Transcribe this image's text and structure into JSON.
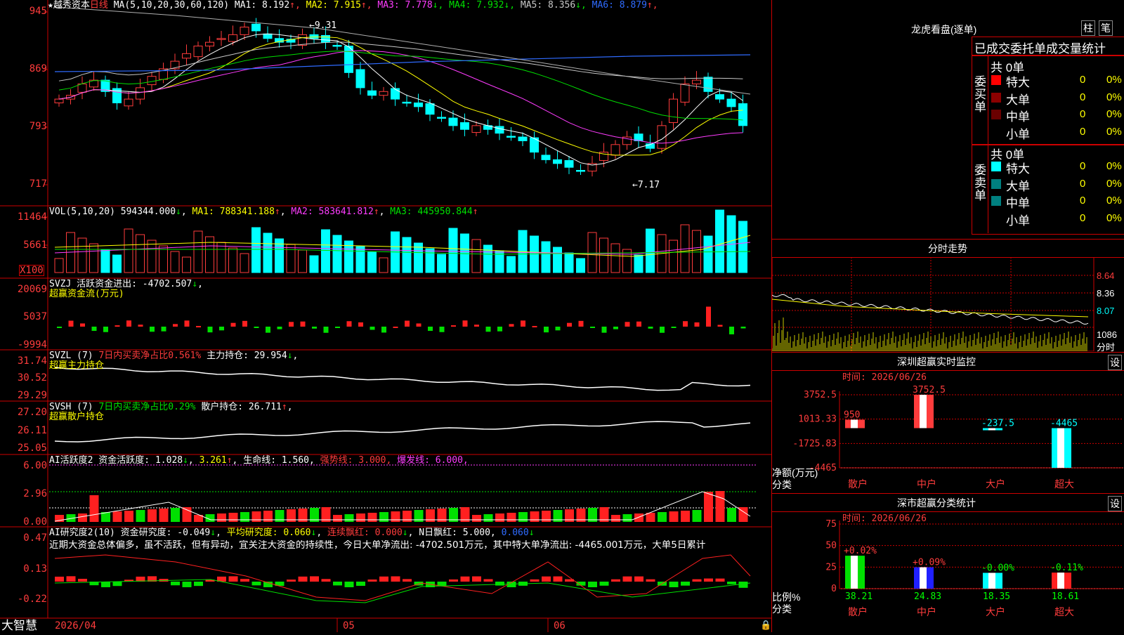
{
  "price_panel": {
    "stock": "越秀资本",
    "period": "日线",
    "ma_params": "MA(5,10,20,30,60,120)",
    "ma": [
      {
        "label": "MA1:",
        "value": "8.192",
        "arrow": "↑",
        "color": "#ffffff"
      },
      {
        "label": "MA2:",
        "value": "7.915",
        "arrow": "↑",
        "color": "#ffff00"
      },
      {
        "label": "MA3:",
        "value": "7.778",
        "arrow": "↓",
        "color": "#ff3cff"
      },
      {
        "label": "MA4:",
        "value": "7.932",
        "arrow": "↓",
        "color": "#00e000"
      },
      {
        "label": "MA5:",
        "value": "8.356",
        "arrow": "↓",
        "color": "#c8c8c8"
      },
      {
        "label": "MA6:",
        "value": "8.879",
        "arrow": "↑",
        "color": "#2f6bff"
      }
    ],
    "y_ticks": [
      "945",
      "869",
      "793",
      "717"
    ],
    "high_label": "9.31",
    "low_label": "7.17"
  },
  "vol_panel": {
    "header": "VOL(5,10,20)",
    "value": "594344.000",
    "value_arrow": "↓",
    "ma1": "MA1: 788341.188",
    "ma1_arrow": "↑",
    "ma2": "MA2: 583641.812",
    "ma2_arrow": "↑",
    "ma3": "MA3: 445950.844",
    "ma3_arrow": "↑",
    "y_ticks": [
      "11464",
      "5661"
    ],
    "unit": "X100"
  },
  "svzj_panel": {
    "header": "SVZJ  活跃资金进出: -4702.507",
    "arrow": "↓",
    "sub": "超赢资金流(万元)",
    "y_ticks": [
      "20069",
      "5037",
      "-9994"
    ]
  },
  "svzl_panel": {
    "header": "SVZL (7)",
    "part2": "7日内买卖净占比0.561%",
    "part3": "主力持仓: 29.954",
    "arrow": "↓",
    "sub": "超赢主力持仓",
    "y_ticks": [
      "31.74",
      "30.52",
      "29.29"
    ]
  },
  "svsh_panel": {
    "header": "SVSH (7)",
    "part2": "7日内买卖净占比0.29%",
    "part3": "散户持仓: 26.711",
    "arrow": "↑",
    "sub": "超赢散户持仓",
    "y_ticks": [
      "27.20",
      "26.11",
      "25.05"
    ]
  },
  "ai_active_panel": {
    "header": "AI活跃度2 资金活跃度: 1.028",
    "v2": "3.261",
    "v3": "生命线: 1.560,",
    "v4": "强势线: 3.000,",
    "v5": "爆发线: 6.000,",
    "y_ticks": [
      "6.00",
      "2.96",
      "0.00"
    ]
  },
  "ai_research_panel": {
    "header": "AI研究度2(10) 资金研究度: -0.049",
    "p2": "平均研究度: 0.060",
    "p3": "连续飘红: 0.000",
    "p4": "N日飘红: 5.000,",
    "p5": "0.060",
    "y_ticks": [
      "0.47",
      "0.13",
      "-0.22"
    ],
    "note": "近期大资金总体偏多，虽不活跃，但有异动，宜关注大资金的持续性，今日大单净流出: -4702.501万元，其中特大单净流出: -4465.001万元，大单5日累计"
  },
  "bottom_bar": {
    "brand": "大智慧",
    "date": "2026/04",
    "month5": "05",
    "month6": "06"
  },
  "dragon_panel": {
    "title": "龙虎看盘(逐单)",
    "btn1": "柱",
    "btn2": "笔",
    "subtitle": "已成交委托单成交量统计",
    "buy": {
      "side": "委买单",
      "total": "共 0单",
      "rows": [
        {
          "name": "特大",
          "v": "0",
          "pct": "0%",
          "color": "#ff0000"
        },
        {
          "name": "大单",
          "v": "0",
          "pct": "0%",
          "color": "#8b0000"
        },
        {
          "name": "中单",
          "v": "0",
          "pct": "0%",
          "color": "#6a0000"
        },
        {
          "name": "小单",
          "v": "0",
          "pct": "0%",
          "color": "#000000"
        }
      ]
    },
    "sell": {
      "side": "委卖单",
      "total": "共 0单",
      "rows": [
        {
          "name": "特大",
          "v": "0",
          "pct": "0%",
          "color": "#00ffff"
        },
        {
          "name": "大单",
          "v": "0",
          "pct": "0%",
          "color": "#008080"
        },
        {
          "name": "中单",
          "v": "0",
          "pct": "0%",
          "color": "#008080"
        },
        {
          "name": "小单",
          "v": "0",
          "pct": "0%",
          "color": "#000000"
        }
      ]
    }
  },
  "intraday_panel": {
    "title": "分时走势",
    "prices": [
      "8.64",
      "8.36",
      "8.07"
    ],
    "volume": "1086",
    "footer": "分时"
  },
  "monitor_panel": {
    "title": "深圳超赢实时监控",
    "btn": "设",
    "time": "时间: 2026/06/26",
    "y_ticks": [
      "3752.5",
      "1013.33",
      "-1725.83",
      "-4465"
    ],
    "ylabel": "净额(万元)",
    "xlabel": "分类"
  },
  "classify_panel": {
    "title": "深市超赢分类统计",
    "btn": "设",
    "time": "时间: 2026/06/26",
    "y_ticks": [
      "75",
      "50",
      "25",
      "0"
    ],
    "ylabel": "比例%",
    "xlabel": "分类"
  },
  "chart_data": [
    {
      "type": "bar",
      "title": "深圳超赢实时监控",
      "categories": [
        "散户",
        "中户",
        "大户",
        "超大"
      ],
      "values": [
        950,
        3752.5,
        -237.5,
        -4465
      ],
      "ylabel": "净额(万元)",
      "xlabel": "分类",
      "ylim": [
        -4465,
        3752.5
      ]
    },
    {
      "type": "bar",
      "title": "深市超赢分类统计",
      "categories": [
        "散户",
        "中户",
        "大户",
        "超大"
      ],
      "values": [
        38.21,
        24.83,
        18.35,
        18.61
      ],
      "changes": [
        "+0.02%",
        "+0.09%",
        "-0.00%",
        "-0.11%"
      ],
      "ylabel": "比例%",
      "xlabel": "分类",
      "ylim": [
        0,
        75
      ]
    }
  ]
}
